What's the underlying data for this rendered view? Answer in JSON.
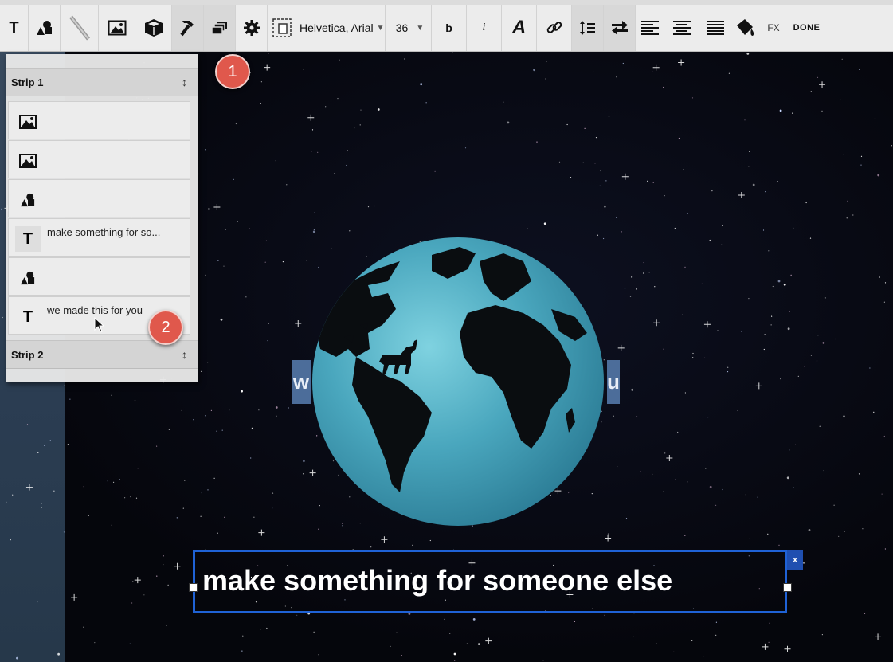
{
  "toolbar": {
    "text_tool_label": "T",
    "font_family": "Helvetica, Arial",
    "font_size": "36",
    "bold_label": "b",
    "italic_label": "i",
    "font_style_label": "A",
    "fx_label": "FX",
    "done_label": "DONE"
  },
  "panel": {
    "strips": [
      {
        "title": "Strip 1",
        "layers": [
          {
            "type": "image",
            "label": ""
          },
          {
            "type": "image",
            "label": ""
          },
          {
            "type": "shape",
            "label": ""
          },
          {
            "type": "text",
            "label": "make something for so..."
          },
          {
            "type": "shape",
            "label": ""
          },
          {
            "type": "text",
            "label": "we made this for you"
          }
        ]
      },
      {
        "title": "Strip 2",
        "layers": []
      }
    ]
  },
  "badges": [
    "1",
    "2"
  ],
  "canvas": {
    "partial_text_left": "w",
    "partial_text_right": "u",
    "selected_text": "make something for someone else",
    "close_label": "x"
  },
  "colors": {
    "selection": "#1f62d6",
    "badge": "#e0584c",
    "globe_water": "#4aa7be",
    "toolbar_bg": "#ececec"
  }
}
